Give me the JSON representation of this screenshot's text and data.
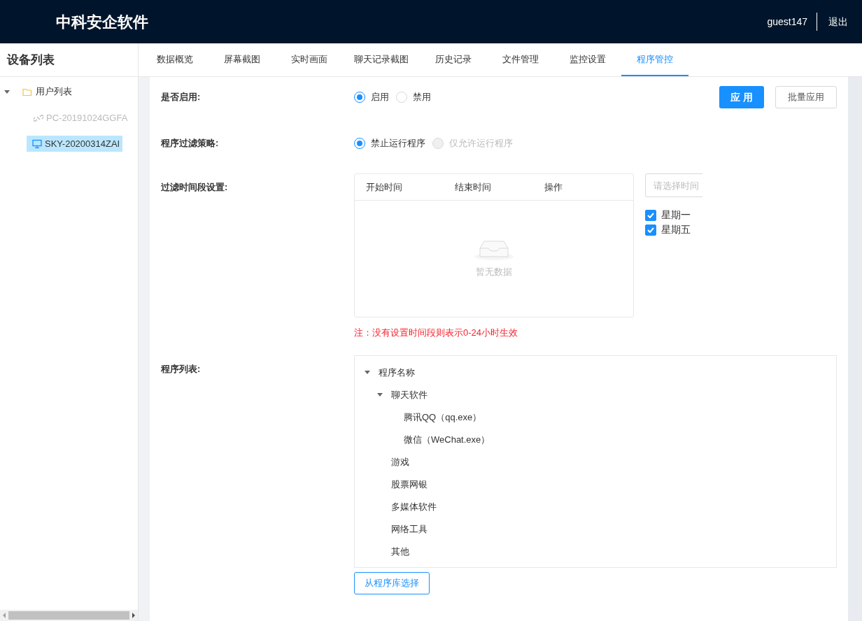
{
  "header": {
    "title": "中科安企软件",
    "user": "guest147",
    "logout": "退出"
  },
  "sidebar": {
    "title": "设备列表",
    "tree": [
      {
        "label": "用户列表",
        "expanded": true,
        "children": [
          {
            "label": "PC-20191024GGFA",
            "online": false,
            "selected": false
          },
          {
            "label": "SKY-20200314ZAI",
            "online": true,
            "selected": true
          }
        ]
      }
    ]
  },
  "tabs": [
    {
      "label": "数据概览",
      "selected": false
    },
    {
      "label": "屏幕截图",
      "selected": false
    },
    {
      "label": "实时画面",
      "selected": false
    },
    {
      "label": "聊天记录截图",
      "selected": false
    },
    {
      "label": "历史记录",
      "selected": false
    },
    {
      "label": "文件管理",
      "selected": false
    },
    {
      "label": "监控设置",
      "selected": false
    },
    {
      "label": "程序管控",
      "selected": true
    }
  ],
  "actions": {
    "apply": "应 用",
    "batch_apply": "批量应用"
  },
  "enable": {
    "label": "是否启用:",
    "options": [
      {
        "label": "启用",
        "selected": true,
        "disabled": false
      },
      {
        "label": "禁用",
        "selected": false,
        "disabled": false
      }
    ]
  },
  "strategy": {
    "label": "程序过滤策略:",
    "options": [
      {
        "label": "禁止运行程序",
        "selected": true,
        "disabled": false
      },
      {
        "label": "仅允许运行程序",
        "selected": false,
        "disabled": true
      }
    ]
  },
  "time_filter": {
    "label": "过滤时间段设置:",
    "columns": [
      "开始时间",
      "结束时间",
      "操作"
    ],
    "empty_text": "暂无数据",
    "picker": {
      "placeholder": "请选择时间"
    },
    "weekdays": [
      {
        "label": "星期一",
        "checked": true
      },
      {
        "label": "星期五",
        "checked": true
      }
    ],
    "note": "注：没有设置时间段则表示0-24小时生效"
  },
  "programs": {
    "label": "程序列表:",
    "tree": [
      {
        "label": "程序名称",
        "expanded": true,
        "children": [
          {
            "label": "聊天软件",
            "expanded": true,
            "children": [
              {
                "label": "腾讯QQ（qq.exe）"
              },
              {
                "label": "微信（WeChat.exe）"
              }
            ]
          },
          {
            "label": "游戏"
          },
          {
            "label": "股票网银"
          },
          {
            "label": "多媒体软件"
          },
          {
            "label": "网络工具"
          },
          {
            "label": "其他"
          }
        ]
      }
    ],
    "library_button": "从程序库选择"
  }
}
